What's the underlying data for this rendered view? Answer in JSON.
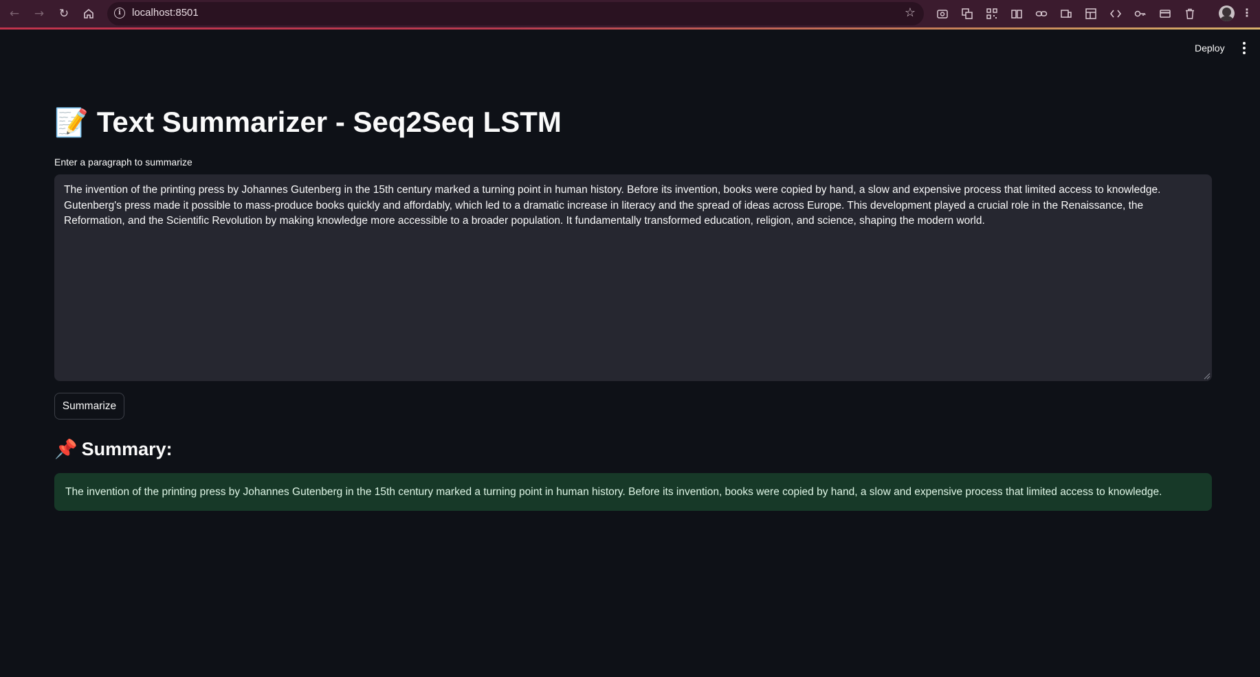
{
  "browser": {
    "url": "localhost:8501"
  },
  "header": {
    "deploy_label": "Deploy"
  },
  "main": {
    "title_emoji": "📝",
    "title": "Text Summarizer - Seq2Seq LSTM",
    "input_label": "Enter a paragraph to summarize",
    "input_value": "The invention of the printing press by Johannes Gutenberg in the 15th century marked a turning point in human history. Before its invention, books were copied by hand, a slow and expensive process that limited access to knowledge. Gutenberg's press made it possible to mass-produce books quickly and affordably, which led to a dramatic increase in literacy and the spread of ideas across Europe. This development played a crucial role in the Renaissance, the Reformation, and the Scientific Revolution by making knowledge more accessible to a broader population. It fundamentally transformed education, religion, and science, shaping the modern world.",
    "button_label": "Summarize",
    "summary_emoji": "📌",
    "summary_heading": "Summary:",
    "summary_text": "The invention of the printing press by Johannes Gutenberg in the 15th century marked a turning point in human history. Before its invention, books were copied by hand, a slow and expensive process that limited access to knowledge."
  },
  "colors": {
    "background": "#0e1117",
    "textarea_bg": "#262730",
    "success_bg": "#173928",
    "chrome_bg": "#3b1b2e"
  }
}
